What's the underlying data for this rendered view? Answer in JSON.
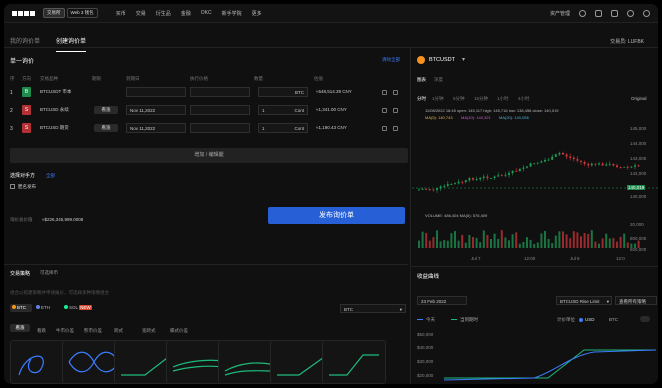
{
  "app": {
    "tabs": [
      "交易所",
      "Web 3 钱包"
    ],
    "nav": [
      "买币",
      "交易",
      "衍生品",
      "金融",
      "OKC",
      "新手学院",
      "更多"
    ],
    "right": [
      "资产管理"
    ]
  },
  "page": {
    "tabs": [
      "我的询价单",
      "创建询价单"
    ],
    "account": "交易员: LUFBK"
  },
  "quote": {
    "title": "单一询价",
    "headers": [
      "序",
      "方向",
      "交易品种",
      "期限",
      "到期日",
      "执行价格",
      "数量",
      "",
      "估值"
    ],
    "clear": "清除全部",
    "rows": [
      {
        "idx": "1",
        "side": "B",
        "side_type": "buy",
        "product": "BTCUSDT 币本",
        "period": "",
        "expiry": "",
        "strike": "",
        "qty": "",
        "unit": "BTC",
        "value": "≈548,514.39 CNY"
      },
      {
        "idx": "2",
        "side": "S",
        "side_type": "sell",
        "product": "BTCUSD 永续",
        "period": "看涨",
        "expiry": "Nov 11,2022",
        "strike": "",
        "qty": "1",
        "unit": "Cont",
        "value": "≈1,341.00 CNY"
      },
      {
        "idx": "3",
        "side": "S",
        "side_type": "sell",
        "product": "BTCUSD 期货",
        "period": "看涨",
        "expiry": "Nov 11,2022",
        "strike": "",
        "qty": "1",
        "unit": "Cont",
        "value": "≈1,190.43 CNY"
      }
    ],
    "add_label": "增加 / 编辑腿"
  },
  "counterparty": {
    "title": "选择对手方",
    "all": "全部",
    "anon": "匿名发布",
    "total_label": "询价总价值",
    "total": "≈$226,345,999.0008",
    "post": "发布询价单"
  },
  "strategy": {
    "tabs": [
      "交易策略",
      "可选择币"
    ],
    "desc": "组合以搭建策略并申请报价，可选择多种策略组合",
    "coins": [
      "BTC",
      "ETH",
      "SOL"
    ],
    "coin_tags": [
      "",
      "",
      "NEW"
    ],
    "select": "BTC",
    "types": [
      "看涨",
      "看跌",
      "牛市价差",
      "熊市价差",
      "跨式",
      "宽跨式",
      "蝶式价差"
    ]
  },
  "chart": {
    "symbol": "BTCUSDT",
    "tabs": [
      "图表",
      "深度"
    ],
    "intervals": [
      "分时",
      "1分钟",
      "5分钟",
      "15分钟",
      "1小时",
      "4小时"
    ],
    "original": "Original",
    "ohlc": "11/08/2022 18:45  open: 145,117  high: 145,716  low: 138,456  close: 140,019",
    "ma": [
      "MA(5): 140,743",
      "MA(10): 140,321",
      "MA(20): 140,056"
    ],
    "volume": "VOLUME: 486,404  MA(5): 576,409",
    "yticks": [
      "145,000",
      "144,000",
      "143,000",
      "142,000",
      "141,000",
      "140,000",
      "139,000",
      "138,000",
      "137,000",
      "140,019"
    ],
    "xticks": [
      "Jul 7",
      "12:00",
      "Jul 8",
      "12:0"
    ],
    "vticks": [
      "20,000",
      "800,000",
      "600,000"
    ]
  },
  "curve": {
    "title": "收益曲线",
    "date": "23 Feb 2022",
    "pair": "BTCUSD Rise Limit",
    "view_btn": "查看所有策略",
    "legend": [
      "今天",
      "当到期时"
    ],
    "unit_label": "计价单位",
    "units": [
      "USD",
      "BTC"
    ],
    "yticks": [
      "$50,000",
      "$40,000",
      "$30,000",
      "$20,000"
    ]
  }
}
